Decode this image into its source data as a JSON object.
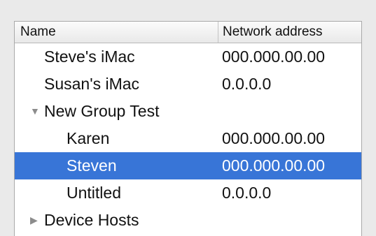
{
  "header": {
    "name_label": "Name",
    "address_label": "Network address"
  },
  "rows": [
    {
      "name": "Steve's iMac",
      "address": "000.000.00.00"
    },
    {
      "name": "Susan's iMac",
      "address": "0.0.0.0"
    },
    {
      "name": "New Group Test",
      "address": "",
      "disclosure": "triangle-down-icon"
    },
    {
      "name": "Karen",
      "address": "000.000.00.00"
    },
    {
      "name": "Steven",
      "address": "000.000.00.00",
      "selected": true
    },
    {
      "name": "Untitled",
      "address": "0.0.0.0"
    },
    {
      "name": "Device Hosts",
      "address": "",
      "disclosure": "triangle-right-icon"
    }
  ],
  "colors": {
    "selection": "#3875d7",
    "window_bg": "#eaeaea",
    "disclosure_triangle": "#8c8c8c"
  }
}
